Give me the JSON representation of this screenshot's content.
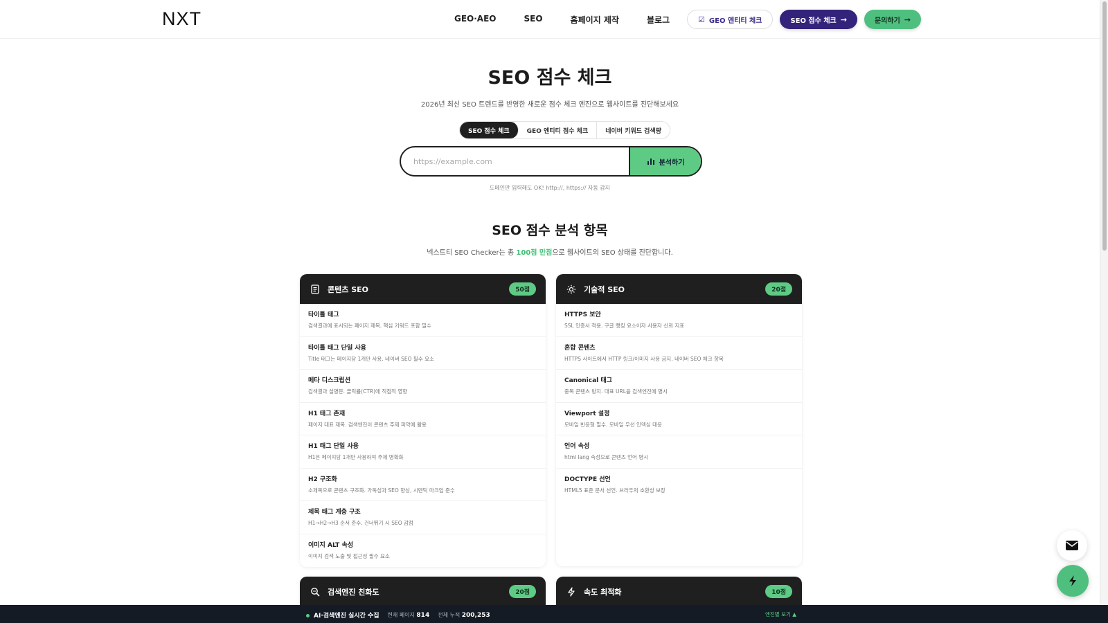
{
  "header": {
    "logo": "NXT",
    "nav": [
      "GEO·AEO",
      "SEO",
      "홈페이지 제작",
      "블로그"
    ],
    "buttons": {
      "geo_check": "GEO 엔티티 체크",
      "seo_check": "SEO 점수 체크",
      "contact": "문의하기"
    }
  },
  "hero": {
    "title": "SEO 점수 체크",
    "subtitle": "2026년 최신 SEO 트렌드를 반영한 새로운 점수 체크 엔진으로 웹사이트를 진단해보세요",
    "tabs": [
      "SEO 점수 체크",
      "GEO 엔티티 점수 체크",
      "네이버 키워드 검색량"
    ],
    "active_tab": 0,
    "search_placeholder": "https://example.com",
    "search_value": "",
    "analyze_label": "분석하기",
    "hint": "도메인만 입력해도 OK! http://, https:// 자동 감지"
  },
  "section": {
    "title": "SEO 점수 분석 항목",
    "sub_prefix": "넥스트티 SEO Checker는 총 ",
    "sub_highlight": "100점 만점",
    "sub_suffix": "으로 웹사이트의 SEO 상태를 진단합니다."
  },
  "cards": [
    {
      "icon": "document-icon",
      "title": "콘텐츠 SEO",
      "score": "50점",
      "items": [
        {
          "name": "타이틀 태그",
          "desc": "검색결과에 표시되는 페이지 제목. 핵심 키워드 포함 필수"
        },
        {
          "name": "타이틀 태그 단일 사용",
          "desc": "Title 태그는 페이지당 1개만 사용. 네이버 SEO 필수 요소"
        },
        {
          "name": "메타 디스크립션",
          "desc": "검색결과 설명문. 클릭률(CTR)에 직접적 영향"
        },
        {
          "name": "H1 태그 존재",
          "desc": "페이지 대표 제목. 검색엔진이 콘텐츠 주제 파악에 활용"
        },
        {
          "name": "H1 태그 단일 사용",
          "desc": "H1은 페이지당 1개만 사용하여 주제 명확화"
        },
        {
          "name": "H2 구조화",
          "desc": "소제목으로 콘텐츠 구조화. 가독성과 SEO 향상, 시멘틱 마크업 준수"
        },
        {
          "name": "제목 태그 계층 구조",
          "desc": "H1→H2→H3 순서 준수. 건너뛰기 시 SEO 감점"
        },
        {
          "name": "이미지 ALT 속성",
          "desc": "이미지 검색 노출 및 접근성 필수 요소"
        }
      ]
    },
    {
      "icon": "gear-icon",
      "title": "기술적 SEO",
      "score": "20점",
      "items": [
        {
          "name": "HTTPS 보안",
          "desc": "SSL 인증서 적용. 구글 랭킹 요소이자 사용자 신뢰 지표"
        },
        {
          "name": "혼합 콘텐츠",
          "desc": "HTTPS 사이트에서 HTTP 링크/이미지 사용 금지. 네이버 SEO 체크 항목"
        },
        {
          "name": "Canonical 태그",
          "desc": "중복 콘텐츠 방지. 대표 URL을 검색엔진에 명시"
        },
        {
          "name": "Viewport 설정",
          "desc": "모바일 반응형 필수. 모바일 우선 인덱싱 대응"
        },
        {
          "name": "언어 속성",
          "desc": "html lang 속성으로 콘텐츠 언어 명시"
        },
        {
          "name": "DOCTYPE 선언",
          "desc": "HTML5 표준 문서 선언. 브라우저 호환성 보장"
        }
      ]
    },
    {
      "icon": "search-icon",
      "title": "검색엔진 친화도",
      "score": "20점",
      "items": []
    },
    {
      "icon": "bolt-icon",
      "title": "속도 최적화",
      "score": "10점",
      "items": []
    }
  ],
  "bottom_bar": {
    "status": "AI·검색엔진 실시간 수집",
    "today_label": "현재 페이지",
    "today_value": "814",
    "total_label": "전체 누적",
    "total_value": "200,253",
    "engines_link": "엔진별 보기 ▲"
  },
  "colors": {
    "accent_green": "#5ecb85",
    "brand_purple": "#34237a",
    "dark": "#1f1f1f"
  }
}
